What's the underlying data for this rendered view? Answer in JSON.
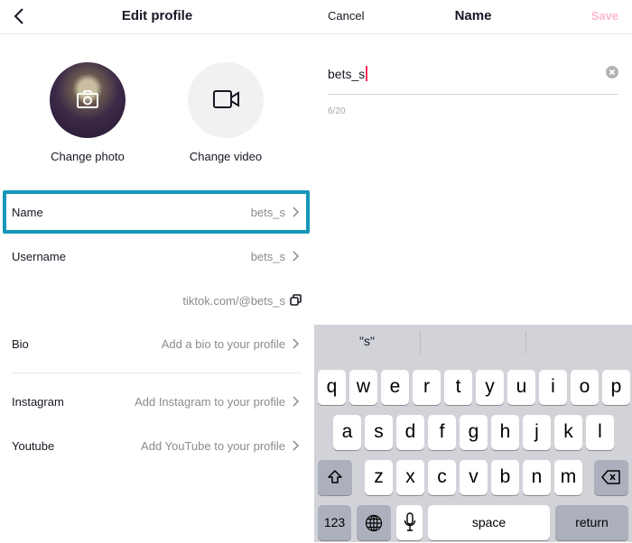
{
  "left": {
    "header": {
      "title": "Edit profile",
      "back_icon": "chevron-left-icon"
    },
    "photo": {
      "label": "Change photo",
      "icon": "camera-icon"
    },
    "video": {
      "label": "Change video",
      "icon": "video-camera-icon"
    },
    "rows": [
      {
        "label": "Name",
        "value": "bets_s",
        "highlighted": true
      },
      {
        "label": "Username",
        "value": "bets_s"
      }
    ],
    "profile_link": {
      "value": "tiktok.com/@bets_s",
      "icon": "copy-icon"
    },
    "bio": {
      "label": "Bio",
      "value": "Add a bio to your profile"
    },
    "social": [
      {
        "label": "Instagram",
        "value": "Add Instagram to your profile"
      },
      {
        "label": "Youtube",
        "value": "Add YouTube to your profile"
      }
    ],
    "highlight_color": "#1597b8"
  },
  "right": {
    "header": {
      "cancel": "Cancel",
      "title": "Name",
      "save": "Save"
    },
    "input": {
      "value": "bets_s",
      "counter": "6/20"
    },
    "colors": {
      "save_disabled": "#fcb9c8",
      "caret": "#fe2c55"
    },
    "keyboard": {
      "suggestions": [
        "\"s\"",
        "",
        ""
      ],
      "row1": [
        "q",
        "w",
        "e",
        "r",
        "t",
        "y",
        "u",
        "i",
        "o",
        "p"
      ],
      "row2": [
        "a",
        "s",
        "d",
        "f",
        "g",
        "h",
        "j",
        "k",
        "l"
      ],
      "row3": [
        "z",
        "x",
        "c",
        "v",
        "b",
        "n",
        "m"
      ],
      "numbers": "123",
      "space": "space",
      "return": "return"
    }
  }
}
